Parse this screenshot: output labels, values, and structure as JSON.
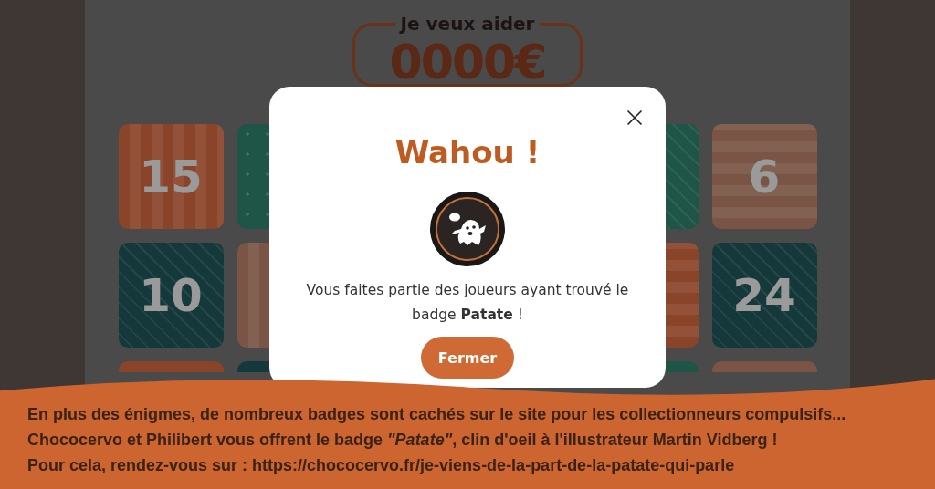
{
  "header": {
    "label": "Je veux aider",
    "amount": "0000€"
  },
  "tile_rows": [
    {
      "left": [
        {
          "number": "15",
          "color": "#8a4429",
          "kind": "stripes-v"
        },
        {
          "color": "#1e5546",
          "kind": "dots"
        }
      ],
      "right": [
        {
          "color": "#1e5546",
          "kind": "diagonal"
        },
        {
          "number": "6",
          "color": "#7a5545",
          "kind": "stripes-h"
        }
      ]
    },
    {
      "left": [
        {
          "number": "10",
          "color": "#15393a",
          "kind": "diagonal"
        },
        {
          "color": "#7a5545",
          "kind": "stripes-v"
        }
      ],
      "right": [
        {
          "color": "#8a4429",
          "kind": "stripes-h"
        },
        {
          "number": "24",
          "color": "#15393a",
          "kind": "diagonal"
        }
      ]
    },
    {
      "left": [
        {
          "color": "#8a4429",
          "kind": "plain"
        },
        {
          "color": "#15393a",
          "kind": "plain"
        }
      ],
      "right": [
        {
          "color": "#1e5546",
          "kind": "plain"
        },
        {
          "color": "#7a5545",
          "kind": "plain"
        }
      ]
    }
  ],
  "modal": {
    "title": "Wahou !",
    "message": "Vous faites partie des joueurs ayant trouvé le badge **Patate** !",
    "button": "Fermer"
  },
  "banner": {
    "lines": [
      "En plus des énigmes, de nombreux badges sont cachés sur le site pour les collectionneurs compulsifs...",
      "Chococervo et Philibert vous offrent le badge *\"Patate\"*, clin d'oeil à l'illustrateur Martin Vidberg !",
      "Pour cela, rendez-vous sur : https://chococervo.fr/je-viens-de-la-part-de-la-patate-qui-parle"
    ]
  }
}
